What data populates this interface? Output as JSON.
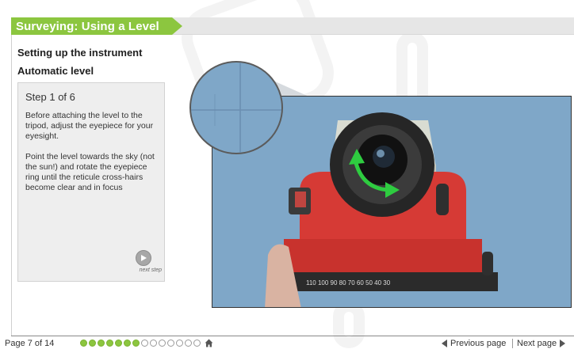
{
  "header": {
    "title": "Surveying: Using a Level"
  },
  "content": {
    "heading": "Setting up the instrument",
    "subheading": "Automatic level"
  },
  "step": {
    "title": "Step 1 of 6",
    "paragraphs": [
      "Before attaching the level to the tripod, adjust the eyepiece for your eyesight.",
      "Point the level towards the sky (not the sun!) and rotate the eyepiece ring until the reticule cross-hairs become clear and in focus"
    ],
    "next_label": "next step"
  },
  "photo": {
    "scale_numbers": "110 100 90 80 70 60 50 40 30"
  },
  "footer": {
    "page_label": "Page  7  of  14",
    "progress": {
      "current": 7,
      "total": 14
    },
    "prev_label": "Previous page",
    "next_label": "Next page"
  },
  "icons": [
    "play-icon",
    "home-icon",
    "prev-arrow-icon",
    "next-arrow-icon",
    "rotate-arrow-icon"
  ],
  "colors": {
    "accent": "#8cc63f",
    "sky": "#7fa7c8",
    "instrument_red": "#d63a35",
    "rotate_arrow": "#2ecc40"
  }
}
